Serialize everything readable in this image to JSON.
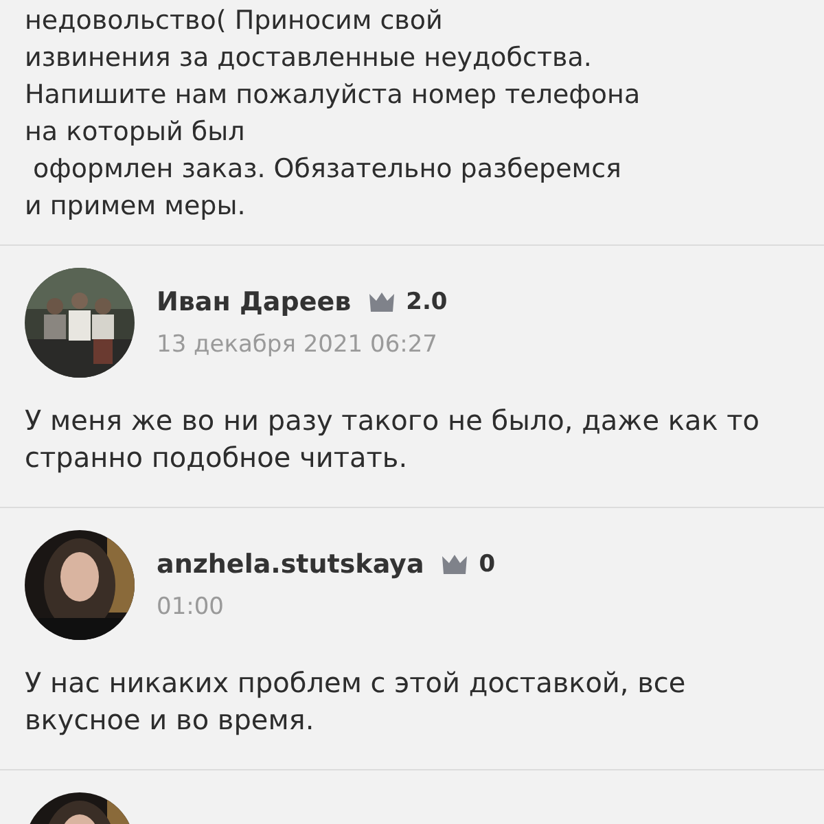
{
  "reply": {
    "text": "недовольство( Приносим свой\nизвинения за доставленные неудобства.\nНапишите нам пожалуйста номер телефона\nна который был\n оформлен заказ. Обязательно разберемся\nи примем меры."
  },
  "reviews": [
    {
      "kind": "full",
      "author": "Иван Дареев",
      "rating": "2.0",
      "date": "13 декабря 2021 06:27",
      "text": "У меня же во ни разу такого не было, даже как то странно подобное читать."
    },
    {
      "kind": "full",
      "author": "anzhela.stutskaya",
      "rating": "0",
      "date": "01:00",
      "text": "У нас никаких проблем с этой доставкой, все вкусное и во время."
    },
    {
      "kind": "partial"
    }
  ]
}
